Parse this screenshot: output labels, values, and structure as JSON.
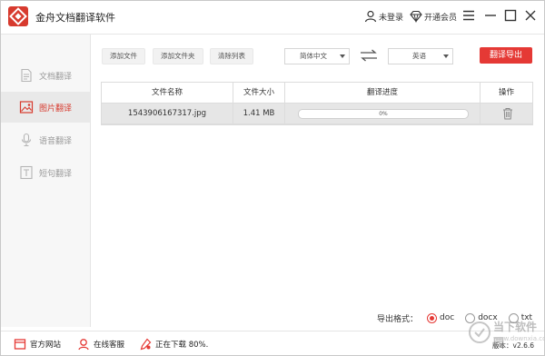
{
  "app": {
    "title": "金舟文档翻译软件"
  },
  "titlebar": {
    "login_label": "未登录",
    "vip_label": "开通会员"
  },
  "sidebar": {
    "items": [
      {
        "label": "文档翻译",
        "icon": "document-icon",
        "active": false
      },
      {
        "label": "图片翻译",
        "icon": "image-icon",
        "active": true
      },
      {
        "label": "语音翻译",
        "icon": "microphone-icon",
        "active": false
      },
      {
        "label": "短句翻译",
        "icon": "text-icon",
        "active": false
      }
    ]
  },
  "toolbar": {
    "add_file": "添加文件",
    "add_folder": "添加文件夹",
    "clear_list": "清除列表",
    "source_lang": "简体中文",
    "target_lang": "英语",
    "translate_export": "翻译导出"
  },
  "table": {
    "headers": [
      "文件名称",
      "文件大小",
      "翻译进度",
      "操作"
    ],
    "rows": [
      {
        "name": "1543906167317.jpg",
        "size": "1.41 MB",
        "progress_text": "0%",
        "progress": 0
      }
    ]
  },
  "export": {
    "label": "导出格式：",
    "options": [
      "doc",
      "docx",
      "txt"
    ],
    "selected": "doc"
  },
  "statusbar": {
    "website": "官方网站",
    "support": "在线客服",
    "download": "正在下载 80%.",
    "version": "版本：v2.6.6"
  },
  "watermark": {
    "line1": "当下软件园",
    "line2": "www.downxia.com"
  },
  "colors": {
    "accent": "#e53935",
    "active_nav_text": "#d73a2e",
    "logo": "#d73a2e"
  }
}
